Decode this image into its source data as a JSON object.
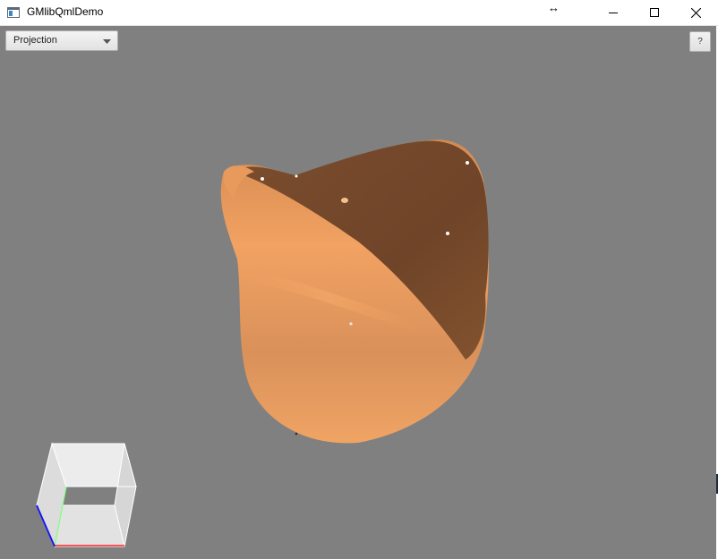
{
  "window": {
    "title": "GMlibQmlDemo",
    "resize_glyph": "↔",
    "controls": [
      "minimize-icon",
      "maximize-icon",
      "close-icon"
    ]
  },
  "toolbar": {
    "projection_label": "Projection",
    "help_label": "?"
  },
  "scene": {
    "background": "#808080",
    "surface_lit_color": "#f0a060",
    "surface_shadow_color": "#7a4c2e",
    "axis_colors": {
      "x": "#ff0000",
      "y": "#00ff00",
      "z": "#0000ff"
    }
  }
}
